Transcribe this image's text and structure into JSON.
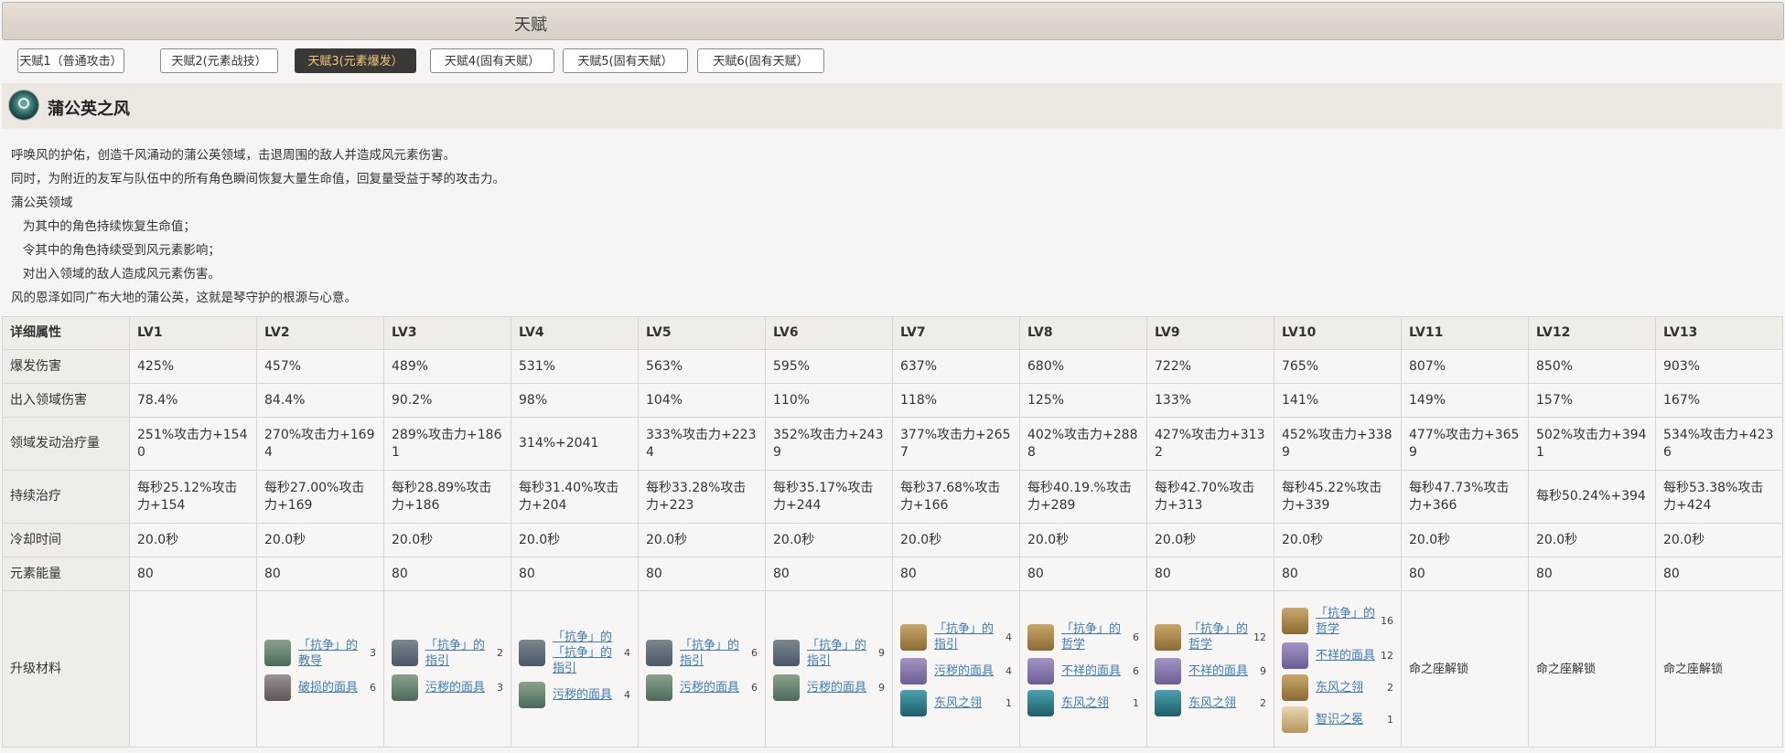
{
  "header": {
    "title": "天赋"
  },
  "tabs": [
    {
      "label": "天赋1（普通攻击）"
    },
    {
      "label": "天赋2(元素战技）"
    },
    {
      "label": "天赋3(元素爆发）"
    },
    {
      "label": "天赋4(固有天赋）"
    },
    {
      "label": "天赋5(固有天赋）"
    },
    {
      "label": "天赋6(固有天赋）"
    }
  ],
  "skill": {
    "name": "蒲公英之风"
  },
  "description": [
    "呼唤风的护佑，创造千风涌动的蒲公英领域，击退周围的敌人并造成风元素伤害。",
    "同时，为附近的友军与队伍中的所有角色瞬间恢复大量生命值，回复量受益于琴的攻击力。",
    "蒲公英领域",
    "   为其中的角色持续恢复生命值；",
    "   令其中的角色持续受到风元素影响；",
    "   对出入领域的敌人造成风元素伤害。",
    "风的恩泽如同广布大地的蒲公英，这就是琴守护的根源与心意。"
  ],
  "table": {
    "header": [
      "详细属性",
      "LV1",
      "LV2",
      "LV3",
      "LV4",
      "LV5",
      "LV6",
      "LV7",
      "LV8",
      "LV9",
      "LV10",
      "LV11",
      "LV12",
      "LV13"
    ],
    "rows": [
      {
        "label": "爆发伤害",
        "values": [
          "425%",
          "457%",
          "489%",
          "531%",
          "563%",
          "595%",
          "637%",
          "680%",
          "722%",
          "765%",
          "807%",
          "850%",
          "903%"
        ]
      },
      {
        "label": "出入领域伤害",
        "values": [
          "78.4%",
          "84.4%",
          "90.2%",
          "98%",
          "104%",
          "110%",
          "118%",
          "125%",
          "133%",
          "141%",
          "149%",
          "157%",
          "167%"
        ]
      },
      {
        "label": "领域发动治疗量",
        "values": [
          "251%攻击力+1540",
          "270%攻击力+1694",
          "289%攻击力+1861",
          "314%+2041",
          "333%攻击力+2234",
          "352%攻击力+2439",
          "377%攻击力+2657",
          "402%攻击力+2888",
          "427%攻击力+3132",
          "452%攻击力+3389",
          "477%攻击力+3659",
          "502%攻击力+3941",
          "534%攻击力+4236"
        ]
      },
      {
        "label": "持续治疗",
        "values": [
          "每秒25.12%攻击力+154",
          "每秒27.00%攻击力+169",
          "每秒28.89%攻击力+186",
          "每秒31.40%攻击力+204",
          "每秒33.28%攻击力+223",
          "每秒35.17%攻击力+244",
          "每秒37.68%攻击力+166",
          "每秒40.19.%攻击力+289",
          "每秒42.70%攻击力+313",
          "每秒45.22%攻击力+339",
          "每秒47.73%攻击力+366",
          "每秒50.24%+394",
          "每秒53.38%攻击力+424"
        ]
      },
      {
        "label": "冷却时间",
        "values": [
          "20.0秒",
          "20.0秒",
          "20.0秒",
          "20.0秒",
          "20.0秒",
          "20.0秒",
          "20.0秒",
          "20.0秒",
          "20.0秒",
          "20.0秒",
          "20.0秒",
          "20.0秒",
          "20.0秒"
        ]
      },
      {
        "label": "元素能量",
        "values": [
          "80",
          "80",
          "80",
          "80",
          "80",
          "80",
          "80",
          "80",
          "80",
          "80",
          "80",
          "80",
          "80"
        ]
      }
    ],
    "materials_label": "升级材料",
    "materials": [
      [],
      [
        {
          "name": "「抗争」的教导",
          "count": "3",
          "icon": "book"
        },
        {
          "name": "破损的面具",
          "count": "6",
          "icon": "mask"
        }
      ],
      [
        {
          "name": "「抗争」的指引",
          "count": "2",
          "icon": "scroll"
        },
        {
          "name": "污秽的面具",
          "count": "3",
          "icon": "book"
        }
      ],
      [
        {
          "name": "「抗争」的「抗争」的指引",
          "count": "4",
          "icon": "scroll"
        },
        {
          "name": "污秽的面具",
          "count": "4",
          "icon": "book"
        }
      ],
      [
        {
          "name": "「抗争」的指引",
          "count": "6",
          "icon": "scroll"
        },
        {
          "name": "污秽的面具",
          "count": "6",
          "icon": "book"
        }
      ],
      [
        {
          "name": "「抗争」的指引",
          "count": "9",
          "icon": "scroll"
        },
        {
          "name": "污秽的面具",
          "count": "9",
          "icon": "book"
        }
      ],
      [
        {
          "name": "「抗争」的指引",
          "count": "4",
          "icon": "gold"
        },
        {
          "name": "污秽的面具",
          "count": "4",
          "icon": "purple"
        },
        {
          "name": "东风之翎",
          "count": "1",
          "icon": "feather"
        }
      ],
      [
        {
          "name": "「抗争」的哲学",
          "count": "6",
          "icon": "gold"
        },
        {
          "name": "不祥的面具",
          "count": "6",
          "icon": "purple"
        },
        {
          "name": "东风之翎",
          "count": "1",
          "icon": "feather"
        }
      ],
      [
        {
          "name": "「抗争」的哲学",
          "count": "12",
          "icon": "gold"
        },
        {
          "name": "不祥的面具",
          "count": "9",
          "icon": "purple"
        },
        {
          "name": "东风之翎",
          "count": "2",
          "icon": "feather"
        }
      ],
      [
        {
          "name": "「抗争」的哲学",
          "count": "16",
          "icon": "gold"
        },
        {
          "name": "不祥的面具",
          "count": "12",
          "icon": "purple"
        },
        {
          "name": "东风之翎",
          "count": "2",
          "icon": "gold"
        },
        {
          "name": "智识之冕",
          "count": "1",
          "icon": "crown"
        }
      ],
      [
        {
          "text": "命之座解锁"
        }
      ],
      [
        {
          "text": "命之座解锁"
        }
      ],
      [
        {
          "text": "命之座解锁"
        }
      ]
    ]
  }
}
